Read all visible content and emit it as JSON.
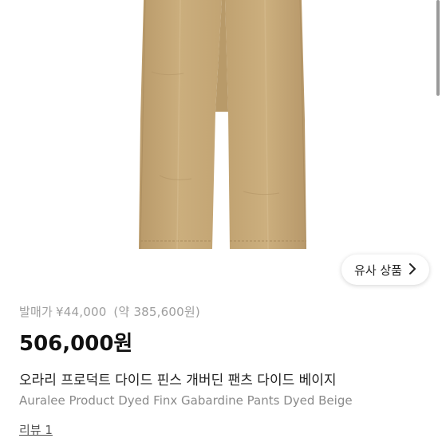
{
  "product_image": {
    "alt_subject": "beige trousers",
    "colors": {
      "fabric": "#c8ab7a",
      "fabric_shadow": "#b59566",
      "background": "#ffffff"
    }
  },
  "similar_button": {
    "label": "유사 상품",
    "icon": "chevron-right-icon"
  },
  "pricing": {
    "original_label": "발매가",
    "original_price": "¥44,000",
    "converted_price": "(약 385,600원)",
    "current_price": "506,000원"
  },
  "product": {
    "title_ko": "오라리 프로덕트 다이드 핀스 개버딘 팬츠 다이드 베이지",
    "title_en": "Auralee Product Dyed Finx Gabardine Pants Dyed Beige"
  },
  "reviews": {
    "label": "리뷰 1"
  }
}
